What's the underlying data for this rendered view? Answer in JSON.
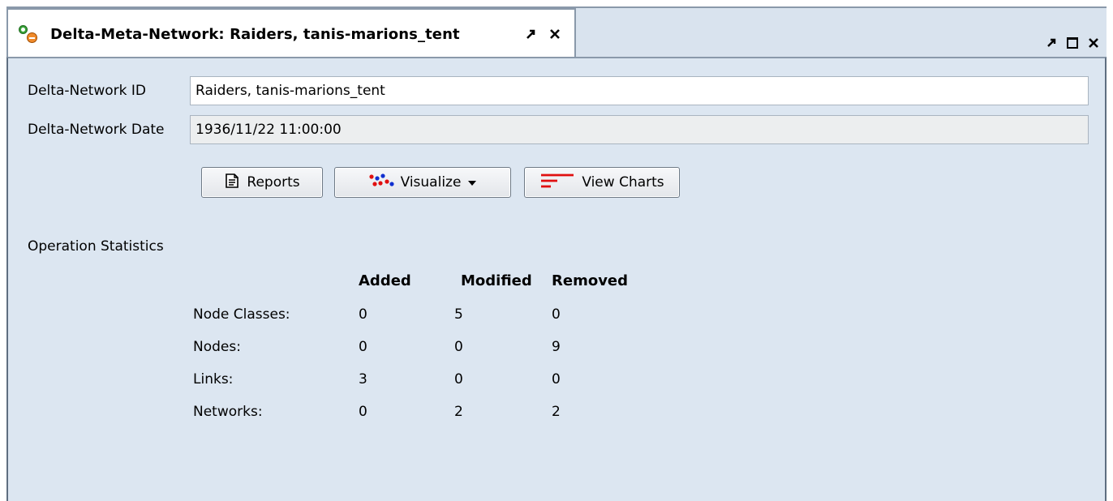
{
  "tab": {
    "title": "Delta-Meta-Network: Raiders, tanis-marions_tent",
    "icon": "delta-network-icon",
    "controls": [
      "float-icon",
      "close-icon"
    ]
  },
  "frame": {
    "controls": [
      "float-icon",
      "maximize-icon",
      "close-icon"
    ]
  },
  "form": {
    "id_label": "Delta-Network ID",
    "id_value": "Raiders, tanis-marions_tent",
    "date_label": "Delta-Network Date",
    "date_value": "1936/11/22 11:00:00"
  },
  "buttons": {
    "reports": "Reports",
    "visualize": "Visualize",
    "view_charts": "View Charts"
  },
  "stats": {
    "section_label": "Operation Statistics",
    "columns": [
      "Added",
      "Modified",
      "Removed"
    ],
    "rows": [
      {
        "label": "Node Classes:",
        "values": [
          "0",
          "5",
          "0"
        ]
      },
      {
        "label": "Nodes:",
        "values": [
          "0",
          "0",
          "9"
        ]
      },
      {
        "label": "Links:",
        "values": [
          "3",
          "0",
          "0"
        ]
      },
      {
        "label": "Networks:",
        "values": [
          "0",
          "2",
          "2"
        ]
      }
    ]
  },
  "colors": {
    "panel_bg": "#dce6f1",
    "tabstrip_bg": "#d9e3ee",
    "chart_icon_red": "#e01010",
    "visualize_dots": [
      "#e01010",
      "#1030d0"
    ]
  }
}
